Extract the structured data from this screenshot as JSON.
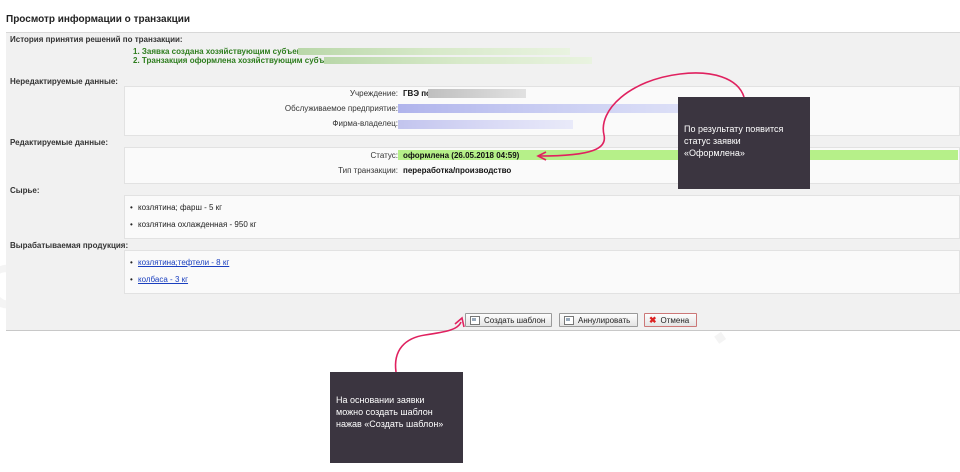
{
  "page": {
    "title": "Просмотр информации о транзакции"
  },
  "history": {
    "header": "История принятия решений по транзакции:",
    "items": [
      "1. Заявка создана хозяйствующим субъектом :",
      "2. Транзакция оформлена хозяйствующим субъектом:"
    ]
  },
  "readonly": {
    "header": "Нередактируемые данные:",
    "institution_label": "Учреждение:",
    "institution_value": "ГВЭ по",
    "enterprise_label": "Обслуживаемое предприятие:",
    "owner_label": "Фирма-владелец:"
  },
  "editable": {
    "header": "Редактируемые данные:",
    "status_label": "Статус:",
    "status_value": "оформлена (26.05.2018 04:59)",
    "type_label": "Тип транзакции:",
    "type_value": "переработка/производство"
  },
  "raw": {
    "header": "Сырье:",
    "items": [
      "козлятина; фарш - 5 кг",
      "козлятина охлажденная - 950 кг"
    ]
  },
  "products": {
    "header": "Вырабатываемая продукция:",
    "items": [
      "козлятина;тефтели - 8 кг",
      "колбаса - 3 кг"
    ]
  },
  "buttons": {
    "create_template": "Создать шаблон",
    "annul": "Аннулировать",
    "cancel": "Отмена"
  },
  "callouts": {
    "status_note": [
      "По результату появится",
      "статус заявки",
      "«Оформлена»"
    ],
    "template_note": [
      "На основании заявки",
      "можно создать шаблон",
      "нажав «Создать шаблон»"
    ]
  },
  "colors": {
    "accent_pink": "#e0215f",
    "callout_bg": "#3b3540",
    "status_bg": "#b6f089",
    "history_text": "#2e7d1e"
  }
}
